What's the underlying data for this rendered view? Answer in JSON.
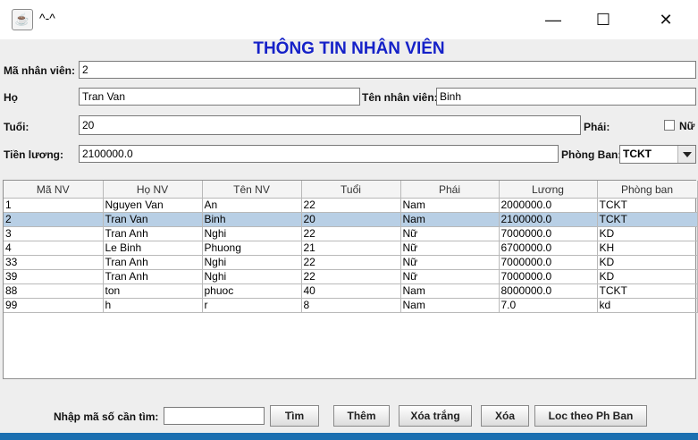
{
  "window": {
    "title": "^-^",
    "minimize_glyph": "—",
    "maximize_glyph": "☐",
    "close_glyph": "✕",
    "app_icon": "java-icon"
  },
  "heading": "THÔNG TIN NHÂN VIÊN",
  "form": {
    "ma_label": "Mã nhân viên:",
    "ma_value": "2",
    "ho_label": "Họ",
    "ho_value": "Tran Van",
    "ten_label": "Tên nhân viên:",
    "ten_value": "Binh",
    "tuoi_label": "Tuổi:",
    "tuoi_value": "20",
    "phai_label": "Phái:",
    "nu_label": "Nữ",
    "luong_label": "Tiền lương:",
    "luong_value": "2100000.0",
    "phongban_label": "Phòng Ban:",
    "phongban_value": "TCKT"
  },
  "table": {
    "headers": [
      "Mã NV",
      "Họ NV",
      "Tên NV",
      "Tuổi",
      "Phái",
      "Lương",
      "Phòng ban"
    ],
    "rows": [
      [
        "1",
        "Nguyen Van",
        "An",
        "22",
        "Nam",
        "2000000.0",
        "TCKT"
      ],
      [
        "2",
        "Tran Van",
        "Binh",
        "20",
        "Nam",
        "2100000.0",
        "TCKT"
      ],
      [
        "3",
        "Tran Anh",
        "Nghi",
        "22",
        "Nữ",
        "7000000.0",
        "KD"
      ],
      [
        "4",
        "Le Binh",
        "Phuong",
        "21",
        "Nữ",
        "6700000.0",
        "KH"
      ],
      [
        "33",
        "Tran Anh",
        "Nghi",
        "22",
        "Nữ",
        "7000000.0",
        "KD"
      ],
      [
        "39",
        "Tran Anh",
        "Nghi",
        "22",
        "Nữ",
        "7000000.0",
        "KD"
      ],
      [
        "88",
        "ton",
        "phuoc",
        "40",
        "Nam",
        "8000000.0",
        "TCKT"
      ],
      [
        "99",
        "h",
        "r",
        "8",
        "Nam",
        "7.0",
        "kd"
      ]
    ]
  },
  "search": {
    "label": "Nhập mã số cần tìm:",
    "value": ""
  },
  "buttons": {
    "tim": "Tìm",
    "them": "Thêm",
    "xoa_trang": "Xóa trắng",
    "xoa": "Xóa",
    "loc": "Loc theo Ph Ban"
  }
}
